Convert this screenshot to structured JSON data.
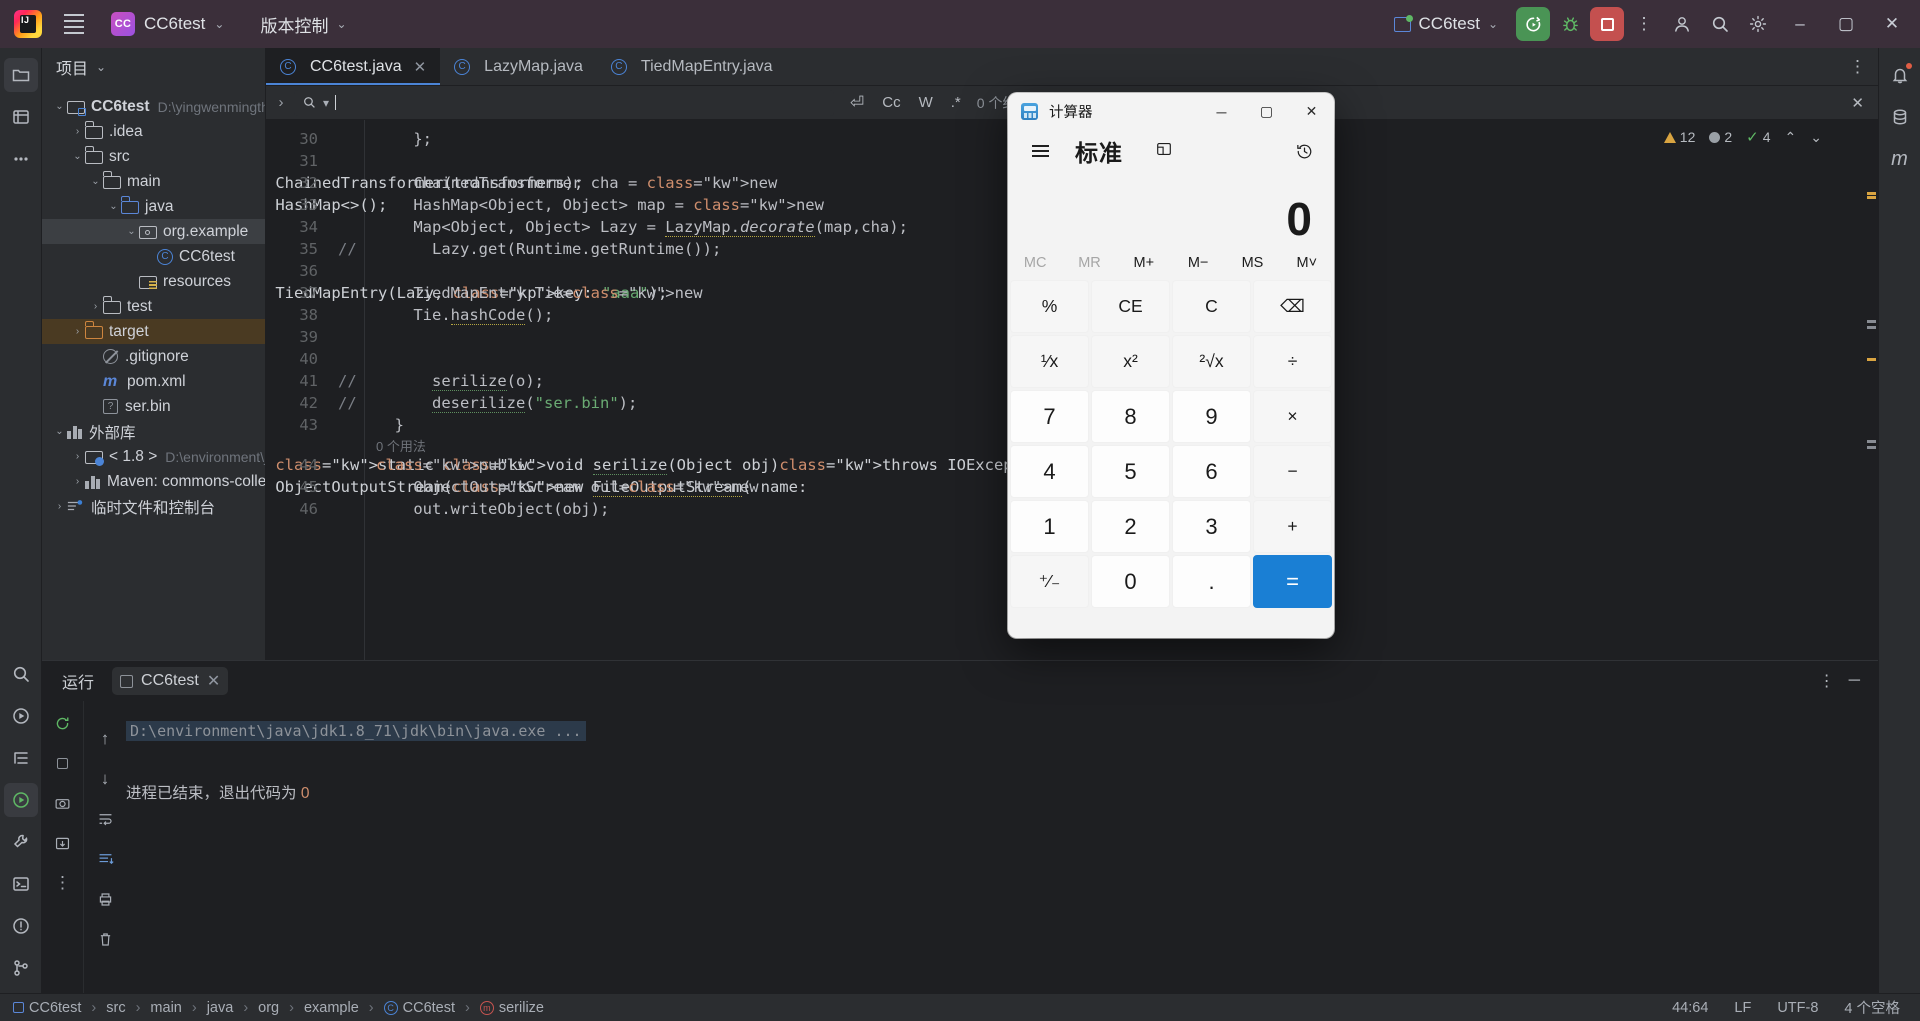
{
  "titlebar": {
    "project_label": "CC6test",
    "project_badge": "CC",
    "vcs_label": "版本控制",
    "run_config": "CC6test",
    "menu_icon": "hamburger-icon",
    "run_icon": "run-rerun-icon",
    "debug_icon": "debug-bug-icon",
    "stop_icon": "stop-square-icon",
    "more_icon": "more-vertical-icon",
    "account_icon": "account-icon",
    "search_icon": "search-icon",
    "settings_icon": "gear-icon",
    "minimize": "–",
    "maximize": "▢",
    "close": "✕"
  },
  "project_panel": {
    "header": "项目",
    "tree": [
      {
        "label": "CC6test",
        "suffix": "D:\\yingwenmingthi",
        "indent": 0,
        "arrow": "v",
        "icon": "module-folder-icon",
        "state": ""
      },
      {
        "label": ".idea",
        "suffix": "",
        "indent": 1,
        "arrow": ">",
        "icon": "folder-icon",
        "state": ""
      },
      {
        "label": "src",
        "suffix": "",
        "indent": 1,
        "arrow": "v",
        "icon": "folder-icon",
        "state": ""
      },
      {
        "label": "main",
        "suffix": "",
        "indent": 2,
        "arrow": "v",
        "icon": "folder-icon",
        "state": ""
      },
      {
        "label": "java",
        "suffix": "",
        "indent": 3,
        "arrow": "v",
        "icon": "source-folder-icon",
        "state": ""
      },
      {
        "label": "org.example",
        "suffix": "",
        "indent": 4,
        "arrow": "v",
        "icon": "package-icon",
        "state": "sel"
      },
      {
        "label": "CC6test",
        "suffix": "",
        "indent": 5,
        "arrow": "",
        "icon": "java-class-icon",
        "state": ""
      },
      {
        "label": "resources",
        "suffix": "",
        "indent": 4,
        "arrow": "",
        "icon": "resources-folder-icon",
        "state": ""
      },
      {
        "label": "test",
        "suffix": "",
        "indent": 2,
        "arrow": ">",
        "icon": "folder-icon",
        "state": ""
      },
      {
        "label": "target",
        "suffix": "",
        "indent": 1,
        "arrow": ">",
        "icon": "target-folder-icon",
        "state": "hl"
      },
      {
        "label": ".gitignore",
        "suffix": "",
        "indent": 2,
        "arrow": "",
        "icon": "gitignore-icon",
        "state": ""
      },
      {
        "label": "pom.xml",
        "suffix": "",
        "indent": 2,
        "arrow": "",
        "icon": "maven-icon",
        "state": ""
      },
      {
        "label": "ser.bin",
        "suffix": "",
        "indent": 2,
        "arrow": "",
        "icon": "unknown-file-icon",
        "state": ""
      },
      {
        "label": "外部库",
        "suffix": "",
        "indent": 0,
        "arrow": "v",
        "icon": "library-icon",
        "state": ""
      },
      {
        "label": "< 1.8 >",
        "suffix": "D:\\environment\\ja",
        "indent": 1,
        "arrow": ">",
        "icon": "jdk-icon",
        "state": ""
      },
      {
        "label": "Maven: commons-collecti",
        "suffix": "",
        "indent": 1,
        "arrow": ">",
        "icon": "library-folder-icon",
        "state": ""
      },
      {
        "label": "临时文件和控制台",
        "suffix": "",
        "indent": 0,
        "arrow": ">",
        "icon": "scratches-icon",
        "state": ""
      }
    ]
  },
  "editor": {
    "tabs": [
      {
        "label": "CC6test.java",
        "active": true,
        "closable": true
      },
      {
        "label": "LazyMap.java",
        "active": false,
        "closable": false
      },
      {
        "label": "TiedMapEntry.java",
        "active": false,
        "closable": false
      }
    ],
    "tab_more_icon": "more-vertical-icon",
    "findbar": {
      "search_value": "",
      "results": "0 个结果",
      "opts": [
        "Cc",
        "W",
        ".*"
      ],
      "regex_icon": "regex-preserve-case-icon",
      "prev_icon": "arrow-up-icon",
      "next_icon": "arrow-down-icon",
      "filter_icon": "filter-icon",
      "more_icon": "more-vertical-icon",
      "close_icon": "close-icon"
    },
    "inspection": {
      "warnings": "12",
      "weak_warnings": "2",
      "ok": "4",
      "warning_icon": "warning-triangle-icon",
      "grey_icon": "grey-dot-icon",
      "check_icon": "checkmark-icon",
      "up_icon": "chevron-up-icon",
      "down_icon": "chevron-down-icon"
    },
    "lines": [
      {
        "n": "30",
        "comment": "",
        "code": "    };"
      },
      {
        "n": "31",
        "comment": "",
        "code": ""
      },
      {
        "n": "32",
        "comment": "",
        "code": "    ChainedTransformer cha = new ChainedTransformer(transformers);"
      },
      {
        "n": "33",
        "comment": "",
        "code": "    HashMap<Object, Object> map = new HashMap<>();"
      },
      {
        "n": "34",
        "comment": "",
        "code": "    Map<Object, Object> Lazy = LazyMap.decorate(map,cha);"
      },
      {
        "n": "35",
        "comment": "//",
        "code": "      Lazy.get(Runtime.getRuntime());"
      },
      {
        "n": "36",
        "comment": "",
        "code": ""
      },
      {
        "n": "37",
        "comment": "",
        "code": "    TiedMapEntry Tie=new TiedMapEntry(Lazy, key: \"aaa\");"
      },
      {
        "n": "38",
        "comment": "",
        "code": "    Tie.hashCode();"
      },
      {
        "n": "39",
        "comment": "",
        "code": ""
      },
      {
        "n": "40",
        "comment": "",
        "code": ""
      },
      {
        "n": "41",
        "comment": "//",
        "code": "      serilize(o);"
      },
      {
        "n": "42",
        "comment": "//",
        "code": "      deserilize(\"ser.bin\");"
      },
      {
        "n": "43",
        "comment": "",
        "code": "  }"
      },
      {
        "n": "44",
        "comment": "",
        "code": "public static void serilize(Object obj)throws IOException {"
      },
      {
        "n": "45",
        "comment": "",
        "code": "    ObjectOutputStream out=new ObjectOutputStream(new FileOutputStream( name:"
      },
      {
        "n": "46",
        "comment": "",
        "code": "    out.writeObject(obj);"
      }
    ],
    "usage_hint": "0 个用法"
  },
  "run_panel": {
    "title": "运行",
    "tab_label": "CC6test",
    "close_icon": "close-icon",
    "rerun_icon": "rerun-icon",
    "stop_icon": "stop-icon",
    "camera_icon": "camera-icon",
    "export_icon": "export-icon",
    "more_icon": "more-vertical-icon",
    "panel_more_icon": "more-vertical-icon",
    "minimize_icon": "minimize-icon",
    "side_icons": [
      "up-arrow-icon",
      "down-arrow-icon",
      "soft-wrap-icon",
      "scroll-to-end-icon",
      "print-icon",
      "trash-icon"
    ],
    "command_line": "D:\\environment\\java\\jdk1.8_71\\jdk\\bin\\java.exe ...",
    "exit_text": "进程已结束，退出代码为",
    "exit_code": "0"
  },
  "status_bar": {
    "breadcrumbs": [
      {
        "label": "CC6test",
        "icon": "module-icon"
      },
      {
        "label": "src",
        "icon": ""
      },
      {
        "label": "main",
        "icon": ""
      },
      {
        "label": "java",
        "icon": ""
      },
      {
        "label": "org",
        "icon": ""
      },
      {
        "label": "example",
        "icon": ""
      },
      {
        "label": "CC6test",
        "icon": "java-class-icon"
      },
      {
        "label": "serilize",
        "icon": "method-icon"
      }
    ],
    "caret": "44:64",
    "line_sep": "LF",
    "encoding": "UTF-8",
    "indent": "4 个空格"
  },
  "left_bar": [
    {
      "icon": "project-folder-icon",
      "active": true
    },
    {
      "icon": "commit-icon",
      "active": false
    },
    {
      "icon": "more-dots-icon",
      "active": false
    },
    {
      "icon": "search-everywhere-icon",
      "active": false
    },
    {
      "icon": "run-panel-icon",
      "active": false
    },
    {
      "icon": "structure-icon",
      "active": false
    },
    {
      "icon": "run-green-icon",
      "active": true
    },
    {
      "icon": "build-icon",
      "active": false
    },
    {
      "icon": "terminal-icon",
      "active": false
    },
    {
      "icon": "problems-icon",
      "active": false
    },
    {
      "icon": "git-branch-icon",
      "active": false
    }
  ],
  "right_bar": [
    {
      "icon": "notifications-bell-icon"
    },
    {
      "icon": "database-icon"
    },
    {
      "icon": "maven-m-icon"
    }
  ],
  "calculator": {
    "window_title": "计算器",
    "app_icon": "calculator-icon",
    "minimize": "─",
    "maximize": "▢",
    "close": "✕",
    "mode": "标准",
    "menu_icon": "hamburger-icon",
    "keep_on_top_icon": "keep-on-top-icon",
    "history_icon": "history-icon",
    "display": "0",
    "memory": [
      {
        "label": "MC",
        "disabled": true
      },
      {
        "label": "MR",
        "disabled": true
      },
      {
        "label": "M+",
        "disabled": false
      },
      {
        "label": "M−",
        "disabled": false
      },
      {
        "label": "MS",
        "disabled": false
      },
      {
        "label": "M˅",
        "disabled": false
      }
    ],
    "keys": [
      {
        "label": "%",
        "type": "fn"
      },
      {
        "label": "CE",
        "type": "fn"
      },
      {
        "label": "C",
        "type": "fn"
      },
      {
        "label": "⌫",
        "type": "fn"
      },
      {
        "label": "¹⁄x",
        "type": "fn"
      },
      {
        "label": "x²",
        "type": "fn"
      },
      {
        "label": "²√x",
        "type": "fn"
      },
      {
        "label": "÷",
        "type": "fn"
      },
      {
        "label": "7",
        "type": "num"
      },
      {
        "label": "8",
        "type": "num"
      },
      {
        "label": "9",
        "type": "num"
      },
      {
        "label": "×",
        "type": "fn"
      },
      {
        "label": "4",
        "type": "num"
      },
      {
        "label": "5",
        "type": "num"
      },
      {
        "label": "6",
        "type": "num"
      },
      {
        "label": "−",
        "type": "fn"
      },
      {
        "label": "1",
        "type": "num"
      },
      {
        "label": "2",
        "type": "num"
      },
      {
        "label": "3",
        "type": "num"
      },
      {
        "label": "+",
        "type": "fn"
      },
      {
        "label": "⁺∕₋",
        "type": "fn"
      },
      {
        "label": "0",
        "type": "num"
      },
      {
        "label": ".",
        "type": "num"
      },
      {
        "label": "=",
        "type": "eq"
      }
    ]
  }
}
